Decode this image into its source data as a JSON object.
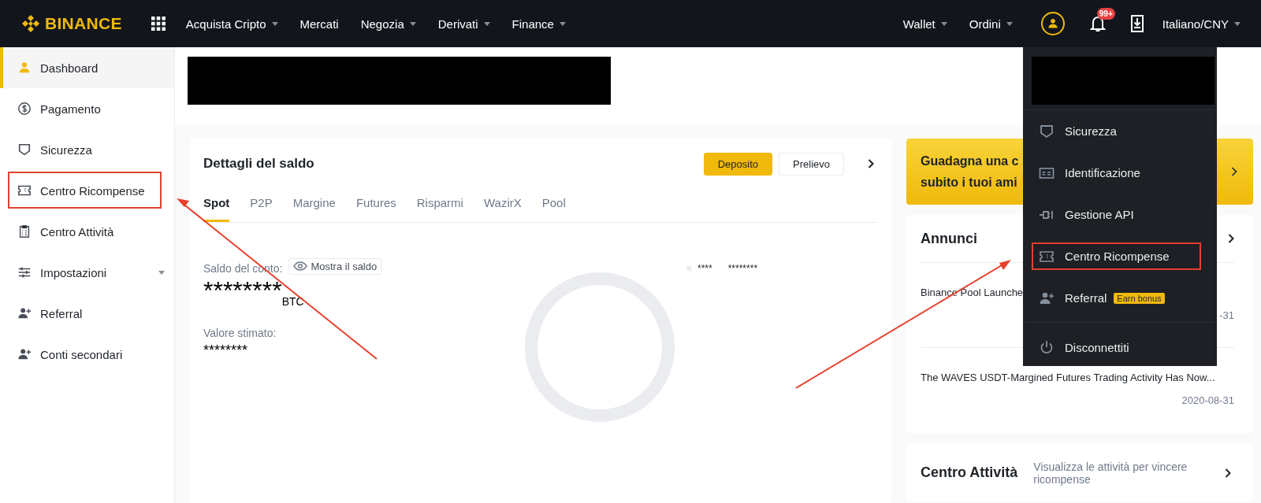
{
  "topbar": {
    "logo": "BINANCE",
    "nav": [
      {
        "label": "Acquista Cripto",
        "dropdown": true
      },
      {
        "label": "Mercati",
        "dropdown": false
      },
      {
        "label": "Negozia",
        "dropdown": true
      },
      {
        "label": "Derivati",
        "dropdown": true
      },
      {
        "label": "Finance",
        "dropdown": true
      }
    ],
    "right_nav": [
      {
        "label": "Wallet",
        "dropdown": true
      },
      {
        "label": "Ordini",
        "dropdown": true
      }
    ],
    "notification_badge": "99+",
    "language": {
      "label": "Italiano/CNY",
      "dropdown": true
    }
  },
  "sidebar": {
    "items": [
      {
        "label": "Dashboard",
        "kind": "user",
        "selected": true,
        "annotated": false,
        "expandable": false
      },
      {
        "label": "Pagamento",
        "kind": "dollar",
        "selected": false,
        "annotated": false,
        "expandable": false
      },
      {
        "label": "Sicurezza",
        "kind": "shield",
        "selected": false,
        "annotated": false,
        "expandable": false
      },
      {
        "label": "Centro Ricompense",
        "kind": "ticket",
        "selected": false,
        "annotated": true,
        "expandable": false
      },
      {
        "label": "Centro Attività",
        "kind": "clipboard",
        "selected": false,
        "annotated": false,
        "expandable": false
      },
      {
        "label": "Impostazioni",
        "kind": "sliders",
        "selected": false,
        "annotated": false,
        "expandable": true
      },
      {
        "label": "Referral",
        "kind": "user-plus",
        "selected": false,
        "annotated": false,
        "expandable": false
      },
      {
        "label": "Conti secondari",
        "kind": "user-plus",
        "selected": false,
        "annotated": false,
        "expandable": false
      }
    ]
  },
  "balance_card": {
    "title": "Dettagli del saldo",
    "buttons": [
      {
        "label": "Deposito",
        "primary": true
      },
      {
        "label": "Prelievo",
        "primary": false
      }
    ],
    "tabs": [
      {
        "label": "Spot",
        "selected": true
      },
      {
        "label": "P2P",
        "selected": false
      },
      {
        "label": "Margine",
        "selected": false
      },
      {
        "label": "Futures",
        "selected": false
      },
      {
        "label": "Risparmi",
        "selected": false
      },
      {
        "label": "WazirX",
        "selected": false
      },
      {
        "label": "Pool",
        "selected": false
      }
    ],
    "account_balance_label": "Saldo del conto:",
    "show_balance_button": "Mostra il saldo",
    "account_balance": "********",
    "currency": "BTC",
    "estimated_value_label": "Valore stimato:",
    "estimated_value": "********",
    "legend": [
      {
        "label": "****",
        "value": "********"
      }
    ]
  },
  "promo_banner": {
    "lines": [
      "Guadagna una c",
      "subito i tuoi ami"
    ]
  },
  "announcements": {
    "title": "Annunci",
    "items": [
      {
        "title": "Binance Pool Launche",
        "date": "-31"
      },
      {
        "title": "The WAVES USDT-Margined Futures Trading Activity Has Now...",
        "date": "2020-08-31"
      }
    ]
  },
  "activity_card": {
    "title": "Centro Attività",
    "description": "Visualizza le attività per vincere ricompense"
  },
  "account_menu": {
    "items": [
      {
        "label": "Sicurezza",
        "kind": "shield",
        "annotated": false
      },
      {
        "label": "Identificazione",
        "kind": "id-card",
        "annotated": false
      },
      {
        "label": "Gestione API",
        "kind": "plug",
        "annotated": false
      },
      {
        "label": "Centro Ricompense",
        "kind": "ticket",
        "annotated": true
      },
      {
        "label": "Referral",
        "kind": "user-plus",
        "annotated": false,
        "badge": "Earn bonus"
      },
      {
        "label": "Disconnettiti",
        "kind": "power",
        "annotated": false
      }
    ]
  }
}
